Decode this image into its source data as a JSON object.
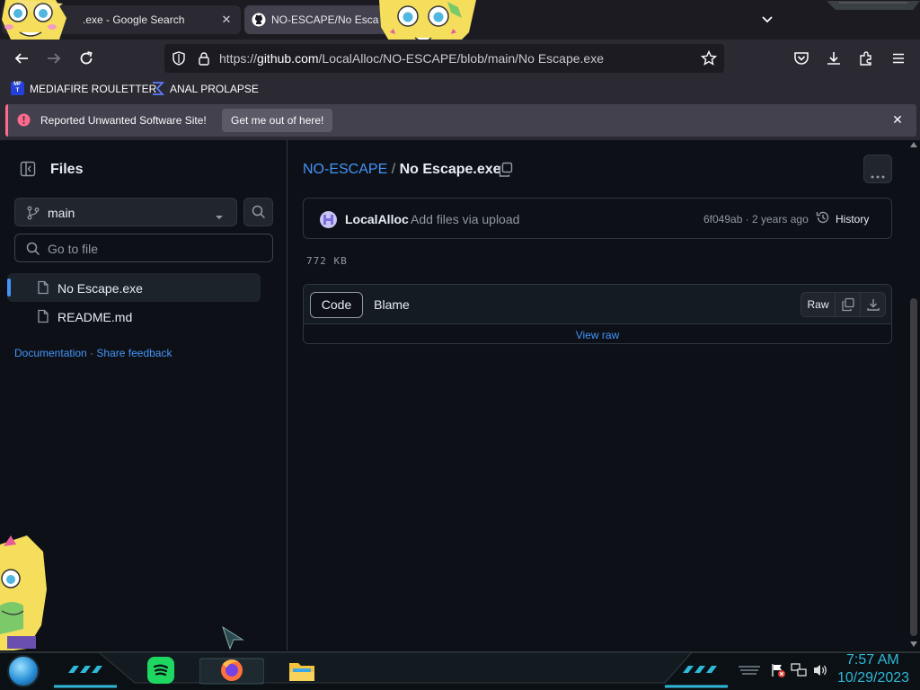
{
  "browser": {
    "tabs": [
      {
        "label": ".exe - Google Search",
        "active": false
      },
      {
        "label": "NO-ESCAPE/No Escap",
        "active": true
      }
    ],
    "url": {
      "prefix": "https://",
      "domain": "github.com",
      "path": "/LocalAlloc/NO-ESCAPE/blob/main/No Escape.exe"
    },
    "bookmarks": [
      {
        "label": "MEDIAFIRE ROULETTER",
        "icon": "mediafire-icon"
      },
      {
        "label": "ANAL PROLAPSE",
        "icon": "sigma-icon"
      }
    ],
    "warning": {
      "text": "Reported Unwanted Software Site!",
      "button": "Get me out of here!"
    }
  },
  "sidebar": {
    "title": "Files",
    "branch": "main",
    "search_placeholder": "Go to file",
    "files": [
      {
        "name": "No Escape.exe",
        "selected": true
      },
      {
        "name": "README.md",
        "selected": false
      }
    ],
    "footer": {
      "documentation": "Documentation",
      "separator": "·",
      "share_feedback": "Share feedback"
    }
  },
  "file": {
    "breadcrumb_repo": "NO-ESCAPE",
    "breadcrumb_sep": "/",
    "breadcrumb_file": "No Escape.exe",
    "commit": {
      "author": "LocalAlloc",
      "message": "Add files via upload",
      "meta": "6f049ab · 2 years ago",
      "history": "History"
    },
    "size": "772 KB",
    "tabs": {
      "code": "Code",
      "blame": "Blame"
    },
    "raw": "Raw",
    "view_raw": "View raw"
  },
  "taskbar": {
    "time": "7:57 AM",
    "date": "10/29/2023"
  },
  "colors": {
    "accent": "#4493f8",
    "warning": "#ff6a8c",
    "clock": "#2fb8d8"
  }
}
